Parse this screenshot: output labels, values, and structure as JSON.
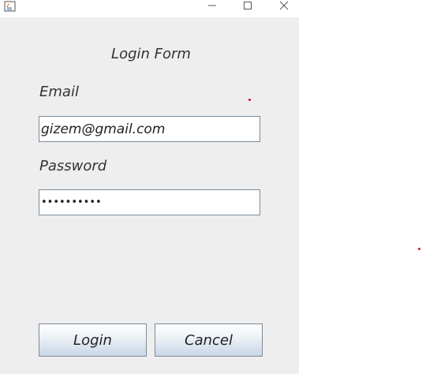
{
  "window": {
    "icon": "java-app-icon",
    "controls": {
      "minimize_icon": "minimize-icon",
      "maximize_icon": "maximize-icon",
      "close_icon": "close-icon"
    }
  },
  "form": {
    "title": "Login Form",
    "email_label": "Email",
    "email_value": "gizem@gmail.com",
    "password_label": "Password",
    "password_masked": "••••••••••",
    "login_label": "Login",
    "cancel_label": "Cancel"
  },
  "colors": {
    "window_bg": "#eeeeee",
    "titlebar_bg": "#ffffff",
    "button_gradient_bottom": "#c9d6e6",
    "marker_dot": "#d0101e"
  }
}
